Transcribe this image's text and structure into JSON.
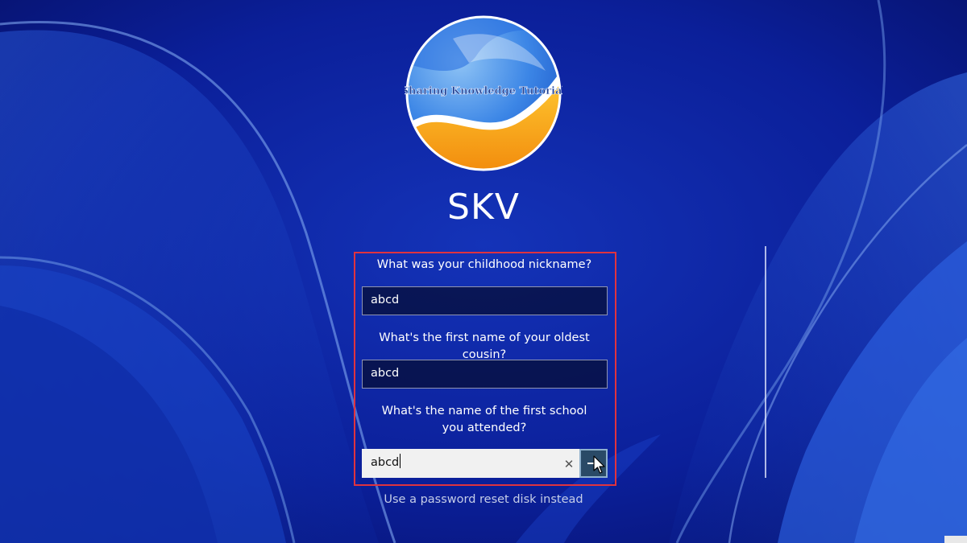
{
  "avatar": {
    "logo_text": "Sharing Knowledge Tutorial"
  },
  "user": {
    "name": "SKV"
  },
  "security_questions": [
    {
      "question": "What was your childhood nickname?",
      "answer": "abcd"
    },
    {
      "question": "What's the first name of your oldest cousin?",
      "answer": "abcd"
    },
    {
      "question": "What's the name of the first school you attended?",
      "answer": "abcd"
    }
  ],
  "controls": {
    "clear_glyph": "✕",
    "submit_icon": "arrow-right-icon"
  },
  "links": {
    "reset_disk": "Use a password reset disk instead"
  },
  "colors": {
    "background": "#0a1a8a",
    "highlight_border": "#e0333f",
    "submit_button": "#2a4a67"
  }
}
